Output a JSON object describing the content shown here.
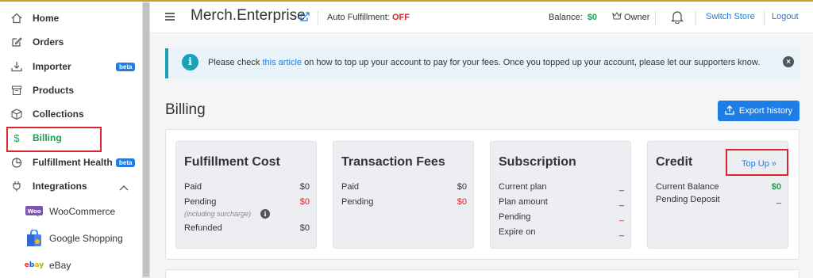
{
  "sidebar": {
    "items": [
      {
        "label": "Home",
        "icon": "home-icon"
      },
      {
        "label": "Orders",
        "icon": "edit-icon"
      },
      {
        "label": "Importer",
        "icon": "download-icon",
        "badge": "beta"
      },
      {
        "label": "Products",
        "icon": "box-icon"
      },
      {
        "label": "Collections",
        "icon": "cube-icon"
      },
      {
        "label": "Billing",
        "icon": "dollar-icon",
        "active": true
      },
      {
        "label": "Fulfillment Health",
        "icon": "pie-icon",
        "badge": "beta"
      },
      {
        "label": "Integrations",
        "icon": "plug-icon"
      }
    ],
    "integrations": [
      {
        "label": "WooCommerce",
        "icon": "woocommerce-logo"
      },
      {
        "label": "Google Shopping",
        "icon": "google-shopping-logo"
      },
      {
        "label": "eBay",
        "icon": "ebay-logo"
      }
    ]
  },
  "header": {
    "store_name": "Merch.Enterprise",
    "auto_fulfillment_label": "Auto Fulfillment:",
    "auto_fulfillment_value": "OFF",
    "balance_label": "Balance:",
    "balance_value": "$0",
    "owner_label": "Owner",
    "switch_store": "Switch Store",
    "logout": "Logout"
  },
  "alert": {
    "text_before": "Please check ",
    "link": "this article",
    "text_after": " on how to top up your account to pay for your fees. Once you topped up your account, please let our supporters know."
  },
  "page": {
    "title": "Billing",
    "export_button": "Export history"
  },
  "cards": {
    "fulfillment": {
      "title": "Fulfillment Cost",
      "paid_label": "Paid",
      "paid_value": "$0",
      "pending_label": "Pending",
      "pending_value": "$0",
      "pending_note": "(including surcharge)",
      "refunded_label": "Refunded",
      "refunded_value": "$0"
    },
    "transaction": {
      "title": "Transaction Fees",
      "paid_label": "Paid",
      "paid_value": "$0",
      "pending_label": "Pending",
      "pending_value": "$0"
    },
    "subscription": {
      "title": "Subscription",
      "current_plan_label": "Current plan",
      "current_plan_value": "_",
      "plan_amount_label": "Plan amount",
      "plan_amount_value": "_",
      "pending_label": "Pending",
      "pending_value": "_",
      "expire_label": "Expire on",
      "expire_value": "_"
    },
    "credit": {
      "title": "Credit",
      "topup_label": "Top Up",
      "current_balance_label": "Current Balance",
      "current_balance_value": "$0",
      "pending_deposit_label": "Pending Deposit",
      "pending_deposit_value": "_"
    }
  },
  "colors": {
    "accent": "#1f7de6",
    "success": "#1f9d55",
    "danger": "#d9262c",
    "info": "#17a2b8"
  }
}
